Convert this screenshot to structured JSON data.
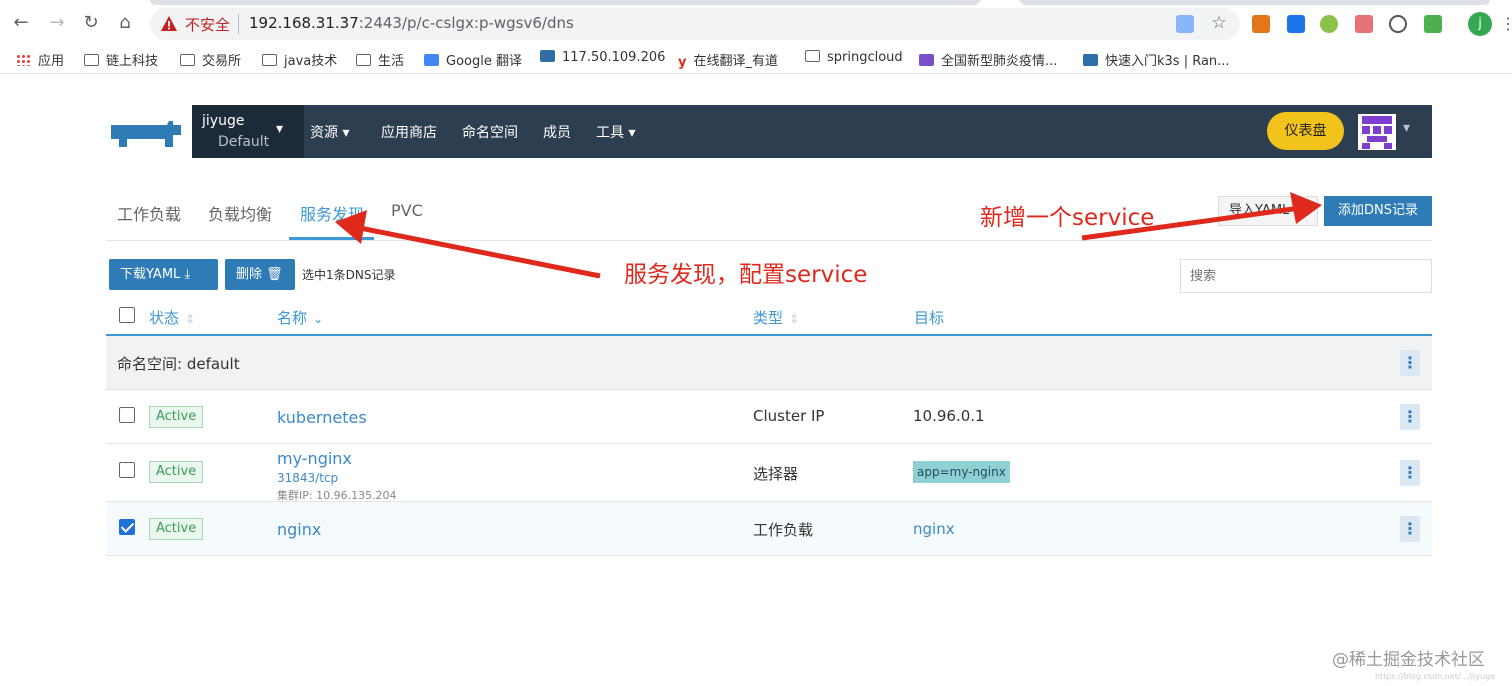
{
  "browser": {
    "insecure_label": "不安全",
    "url_host": "192.168.31.37",
    "url_path": ":2443/p/c-cslgx:p-wgsv6/dns",
    "bookmarks": [
      {
        "label": "应用"
      },
      {
        "label": "链上科技"
      },
      {
        "label": "交易所"
      },
      {
        "label": "java技术"
      },
      {
        "label": "生活"
      },
      {
        "label": "Google 翻译"
      },
      {
        "label": "117.50.109.206"
      },
      {
        "label": "在线翻译_有道"
      },
      {
        "label": "springcloud"
      },
      {
        "label": "全国新型肺炎疫情..."
      },
      {
        "label": "快速入门k3s | Ran..."
      }
    ],
    "profile_initial": "j"
  },
  "header": {
    "cluster_name": "jiyuge",
    "project_name": "Default",
    "nav": [
      {
        "label": "资源"
      },
      {
        "label": "应用商店"
      },
      {
        "label": "命名空间"
      },
      {
        "label": "成员"
      },
      {
        "label": "工具"
      }
    ],
    "dashboard_label": "仪表盘"
  },
  "tabs": [
    {
      "label": "工作负载"
    },
    {
      "label": "负载均衡"
    },
    {
      "label": "服务发现"
    },
    {
      "label": "PVC"
    }
  ],
  "actions": {
    "import_label": "导入YAML",
    "add_label": "添加DNS记录",
    "download_label": "下载YAML",
    "delete_label": "删除",
    "selection_text": "选中1条DNS记录",
    "search_placeholder": "搜索"
  },
  "table": {
    "columns": [
      "状态",
      "名称",
      "类型",
      "目标"
    ],
    "group_label": "命名空间: default",
    "rows": [
      {
        "status": "Active",
        "name": "kubernetes",
        "type": "Cluster IP",
        "target": "10.96.0.1",
        "checked": false
      },
      {
        "status": "Active",
        "name": "my-nginx",
        "port": "31843/tcp",
        "cluster_ip": "集群IP: 10.96.135.204",
        "type": "选择器",
        "target": "app=my-nginx",
        "checked": false
      },
      {
        "status": "Active",
        "name": "nginx",
        "type": "工作负载",
        "target": "nginx",
        "checked": true
      }
    ]
  },
  "annotations": {
    "add_service": "新增一个service",
    "service_discovery": "服务发现，配置service"
  },
  "watermark": "@稀土掘金技术社区",
  "watermark_small": "https://blog.csdn.net/.../jiyuge"
}
